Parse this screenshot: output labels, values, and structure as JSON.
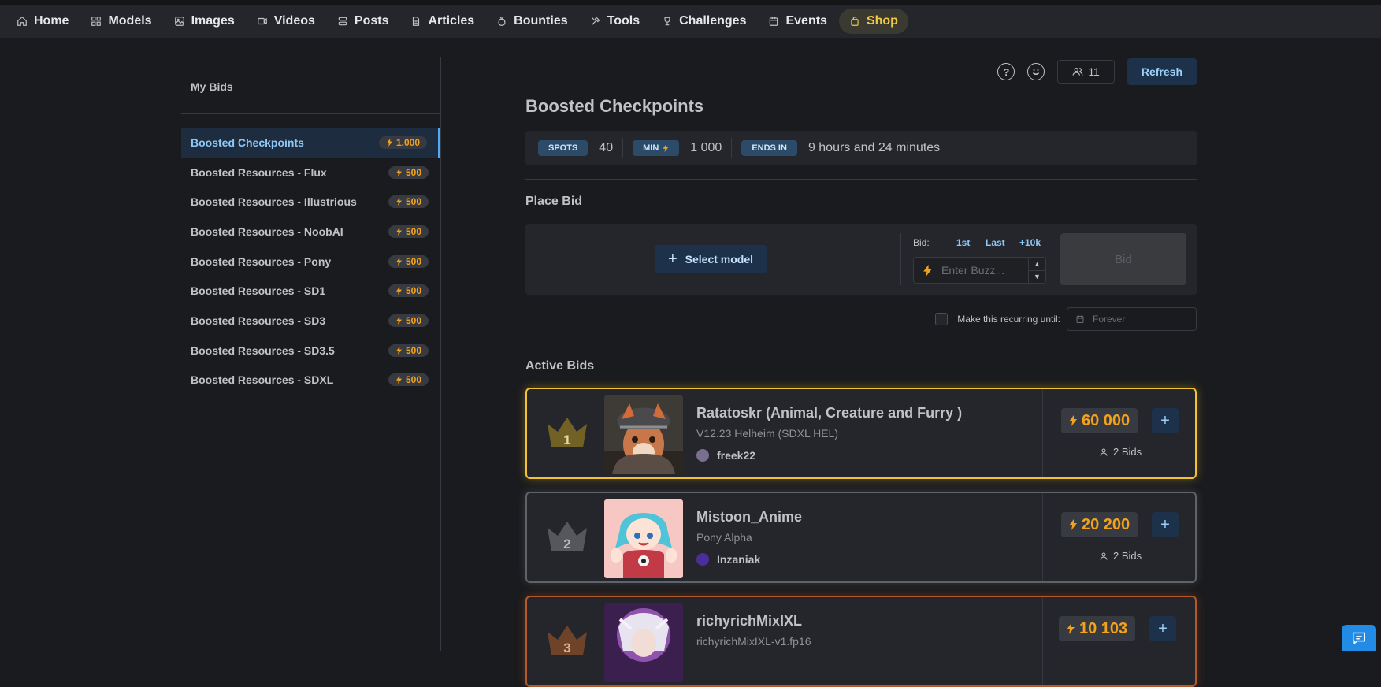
{
  "nav": {
    "items": [
      {
        "label": "Home",
        "icon": "home-icon"
      },
      {
        "label": "Models",
        "icon": "grid-icon"
      },
      {
        "label": "Images",
        "icon": "photo-icon"
      },
      {
        "label": "Videos",
        "icon": "video-icon"
      },
      {
        "label": "Posts",
        "icon": "layers-icon"
      },
      {
        "label": "Articles",
        "icon": "file-text-icon"
      },
      {
        "label": "Bounties",
        "icon": "moneybag-icon"
      },
      {
        "label": "Tools",
        "icon": "tools-icon"
      },
      {
        "label": "Challenges",
        "icon": "trophy-icon"
      },
      {
        "label": "Events",
        "icon": "calendar-icon"
      },
      {
        "label": "Shop",
        "icon": "shopping-bag-icon",
        "color": "#f3c846"
      }
    ]
  },
  "sidebar": {
    "title": "My Bids",
    "items": [
      {
        "label": "Boosted Checkpoints",
        "price": "1,000",
        "active": true
      },
      {
        "label": "Boosted Resources - Flux",
        "price": "500"
      },
      {
        "label": "Boosted Resources - Illustrious",
        "price": "500"
      },
      {
        "label": "Boosted Resources - NoobAI",
        "price": "500"
      },
      {
        "label": "Boosted Resources - Pony",
        "price": "500"
      },
      {
        "label": "Boosted Resources - SD1",
        "price": "500"
      },
      {
        "label": "Boosted Resources - SD3",
        "price": "500"
      },
      {
        "label": "Boosted Resources - SD3.5",
        "price": "500"
      },
      {
        "label": "Boosted Resources - SDXL",
        "price": "500"
      }
    ]
  },
  "toolbar": {
    "help_icon": "question-circle-icon",
    "emoji_icon": "smiley-icon",
    "users_count": "11",
    "refresh_label": "Refresh"
  },
  "page": {
    "title": "Boosted Checkpoints",
    "stats": {
      "spots_label": "SPOTS",
      "spots_value": "40",
      "min_label": "MIN",
      "min_value": "1 000",
      "ends_label": "ENDS IN",
      "ends_value": "9 hours and 24 minutes"
    }
  },
  "place_bid": {
    "title": "Place Bid",
    "select_model_label": "Select model",
    "bid_label": "Bid:",
    "quick_first": "1st",
    "quick_last": "Last",
    "quick_plus": "+10k",
    "input_placeholder": "Enter Buzz...",
    "bid_button": "Bid",
    "recurring_label": "Make this recurring until:",
    "date_placeholder": "Forever"
  },
  "active_bids": {
    "title": "Active Bids",
    "items": [
      {
        "rank": "1",
        "name": "Ratatoskr (Animal, Creature and Furry )",
        "version": "V12.23 Helheim (SDXL HEL)",
        "creator": "freek22",
        "amount": "60 000",
        "bids": "2 Bids",
        "tier": "gold"
      },
      {
        "rank": "2",
        "name": "Mistoon_Anime",
        "version": "Pony Alpha",
        "creator": "Inzaniak",
        "amount": "20 200",
        "bids": "2 Bids",
        "tier": "silver"
      },
      {
        "rank": "3",
        "name": "richyrichMixIXL",
        "version": "richyrichMixIXL-v1.fp16",
        "creator": "",
        "amount": "10 103",
        "bids": "",
        "tier": "bronze"
      }
    ]
  },
  "colors": {
    "accent": "#4dabf7",
    "buzz": "#f3a21c",
    "gold": "#f1c332",
    "silver": "#5f6268",
    "bronze": "#b3592a"
  }
}
